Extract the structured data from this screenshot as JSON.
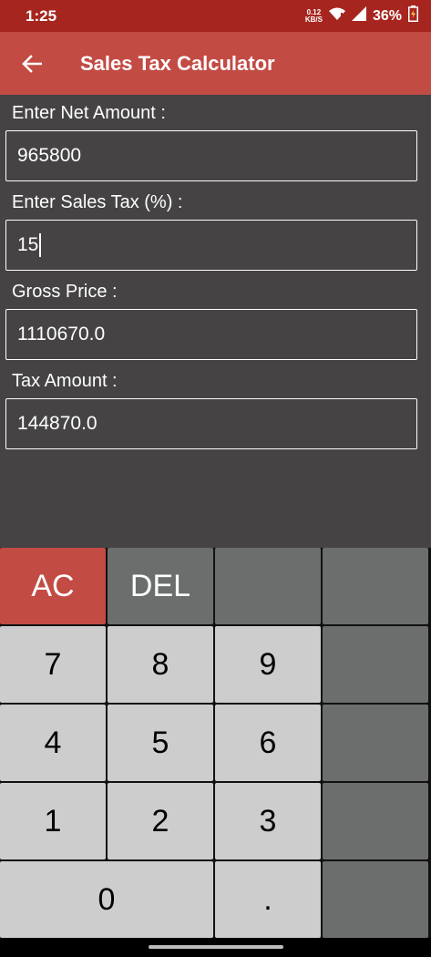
{
  "status_bar": {
    "time": "1:25",
    "net_speed_value": "0.12",
    "net_speed_unit": "KB/S",
    "battery": "36%",
    "icons": [
      "wifi-icon",
      "signal-icon",
      "battery-icon"
    ]
  },
  "app_bar": {
    "title": "Sales Tax Calculator",
    "back_icon": "arrow-left-icon",
    "color": "#c24b44"
  },
  "fields": {
    "net_amount": {
      "label": "Enter Net Amount :",
      "value": "965800"
    },
    "sales_tax": {
      "label": "Enter Sales Tax (%) :",
      "value": "15"
    },
    "gross_price": {
      "label": "Gross Price :",
      "value": "1110670.0"
    },
    "tax_amount": {
      "label": "Tax Amount :",
      "value": "144870.0"
    }
  },
  "keypad": {
    "ac": "AC",
    "del": "DEL",
    "k7": "7",
    "k8": "8",
    "k9": "9",
    "k4": "4",
    "k5": "5",
    "k6": "6",
    "k1": "1",
    "k2": "2",
    "k3": "3",
    "k0": "0",
    "dot": "."
  },
  "colors": {
    "status_bar": "#a6261f",
    "accent": "#c24b44",
    "background": "#454343",
    "key_number": "#cdcdcd",
    "key_function": "#6c6e6d"
  }
}
